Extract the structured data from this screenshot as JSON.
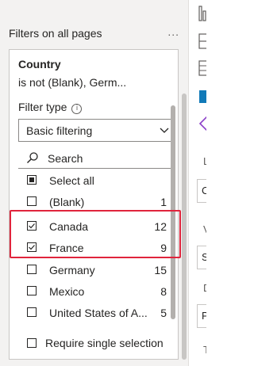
{
  "pane": {
    "title": "Filters on all pages",
    "more": "..."
  },
  "card": {
    "title": "Country",
    "summary": "is not (Blank), Germ...",
    "filter_type_label": "Filter type",
    "filter_type_value": "Basic filtering",
    "search_label": "Search",
    "items": [
      {
        "label": "Select all",
        "count": "",
        "state": "partial"
      },
      {
        "label": "(Blank)",
        "count": "1",
        "state": "unchecked"
      },
      {
        "label": "Canada",
        "count": "12",
        "state": "checked"
      },
      {
        "label": "France",
        "count": "9",
        "state": "checked"
      },
      {
        "label": "Germany",
        "count": "15",
        "state": "unchecked"
      },
      {
        "label": "Mexico",
        "count": "8",
        "state": "unchecked"
      },
      {
        "label": "United States of A...",
        "count": "5",
        "state": "unchecked"
      }
    ],
    "require_single": "Require single selection"
  },
  "side": {
    "letters": [
      "L",
      "V",
      "D",
      "T"
    ],
    "boxes": [
      "C",
      "S",
      "P"
    ]
  },
  "colors": {
    "highlight": "#e0243c",
    "pane_bg": "#f3f2f1",
    "accent_purple": "#8a3cc8",
    "accent_blue": "#117ab8"
  }
}
